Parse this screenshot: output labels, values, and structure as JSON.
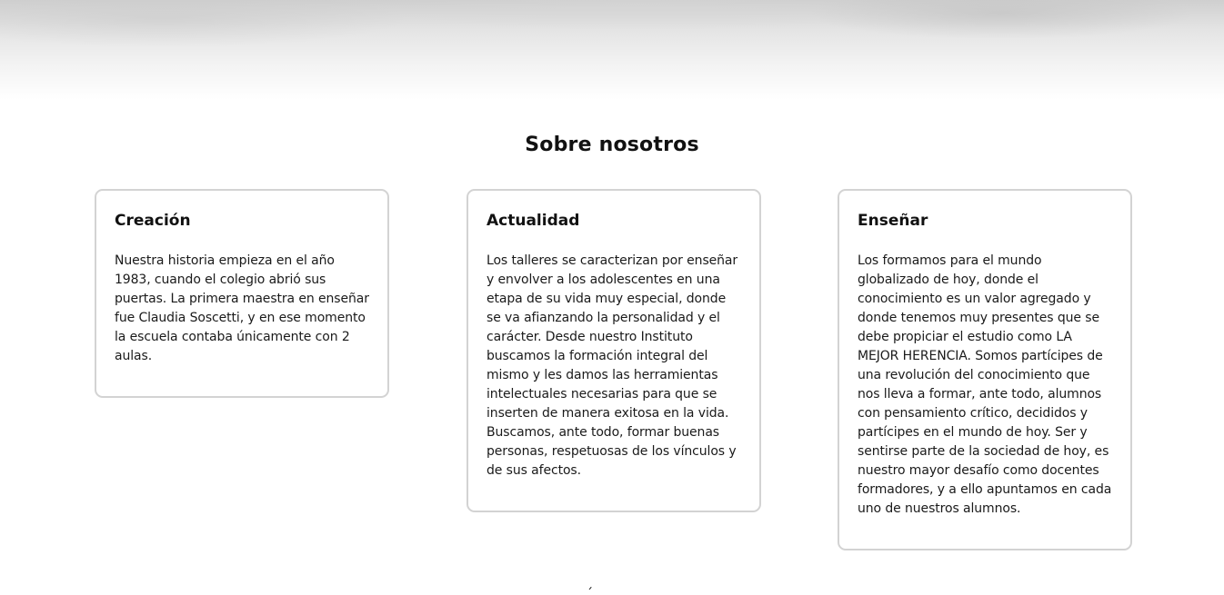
{
  "section": {
    "title": "Sobre nosotros"
  },
  "cards": [
    {
      "title": "Creación",
      "text": "Nuestra historia empieza en el año 1983, cuando el colegio abrió sus puertas. La primera maestra en enseñar fue Claudia Soscetti, y en ese momento la escuela contaba únicamente con 2 aulas."
    },
    {
      "title": "Actualidad",
      "text": "Los talleres se caracterizan por enseñar y envolver a los adolescentes en una etapa de su vida muy especial, donde se va afianzando la personalidad y el carácter. Desde nuestro Instituto buscamos la formación integral del mismo y les damos las herramientas intelectuales necesarias para que se inserten de manera exitosa en la vida. Buscamos, ante todo, formar buenas personas, respetuosas de los vínculos y de sus afectos."
    },
    {
      "title": "Enseñar",
      "text": "Los formamos para el mundo globalizado de hoy, donde el conocimiento es un valor agregado y donde tenemos muy presentes que se debe propiciar el estudio como LA MEJOR HERENCIA. Somos partícipes de una revolución del conocimiento que nos lleva a formar, ante todo, alumnos con pensamiento crítico, decididos y partícipes en el mundo de hoy. Ser y sentirse parte de la sociedad de hoy, es nuestro mayor desafío como docentes formadores, y a ello apuntamos en cada uno de nuestros alumnos."
    }
  ]
}
